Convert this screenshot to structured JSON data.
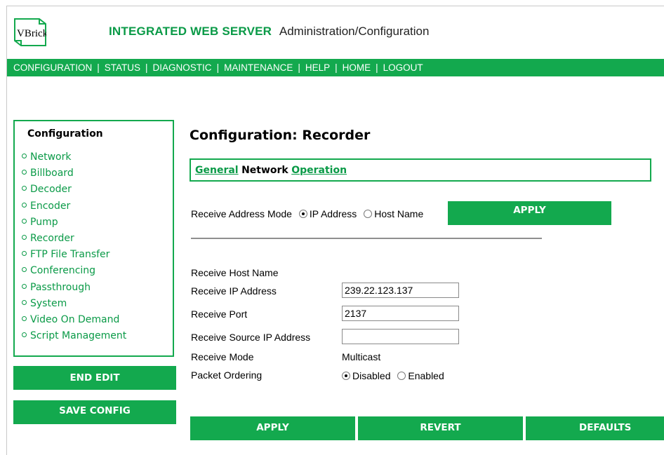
{
  "header": {
    "logo_text": "VBrick",
    "title_strong": "INTEGRATED WEB SERVER",
    "title_sub": "Administration/Configuration"
  },
  "nav": {
    "items": [
      "CONFIGURATION",
      "STATUS",
      "DIAGNOSTIC",
      "MAINTENANCE",
      "HELP",
      "HOME",
      "LOGOUT"
    ],
    "separator": "|"
  },
  "sidebar": {
    "heading": "Configuration",
    "items": [
      "Network",
      "Billboard",
      "Decoder",
      "Encoder",
      "Pump",
      "Recorder",
      "FTP File Transfer",
      "Conferencing",
      "Passthrough",
      "System",
      "Video On Demand",
      "Script Management"
    ]
  },
  "buttons": {
    "end_edit": "END EDIT",
    "save_config": "SAVE CONFIG",
    "apply_top": "APPLY",
    "apply": "APPLY",
    "revert": "REVERT",
    "defaults": "DEFAULTS"
  },
  "page": {
    "title": "Configuration: Recorder",
    "tabs": [
      {
        "label": "General",
        "active": false
      },
      {
        "label": "Network",
        "active": true
      },
      {
        "label": "Operation",
        "active": false
      }
    ]
  },
  "form": {
    "receive_address_mode": {
      "label": "Receive Address Mode",
      "options": [
        "IP Address",
        "Host Name"
      ],
      "selected": "IP Address"
    },
    "receive_host_name_label": "Receive Host Name",
    "receive_ip": {
      "label": "Receive IP Address",
      "value": "239.22.123.137"
    },
    "receive_port": {
      "label": "Receive Port",
      "value": "2137"
    },
    "receive_source_ip": {
      "label": "Receive Source IP Address",
      "value": ""
    },
    "receive_mode": {
      "label": "Receive Mode",
      "value": "Multicast"
    },
    "packet_ordering": {
      "label": "Packet Ordering",
      "options": [
        "Disabled",
        "Enabled"
      ],
      "selected": "Disabled"
    }
  },
  "colors": {
    "brand_green": "#13a94e",
    "link_green": "#0a9a47"
  }
}
